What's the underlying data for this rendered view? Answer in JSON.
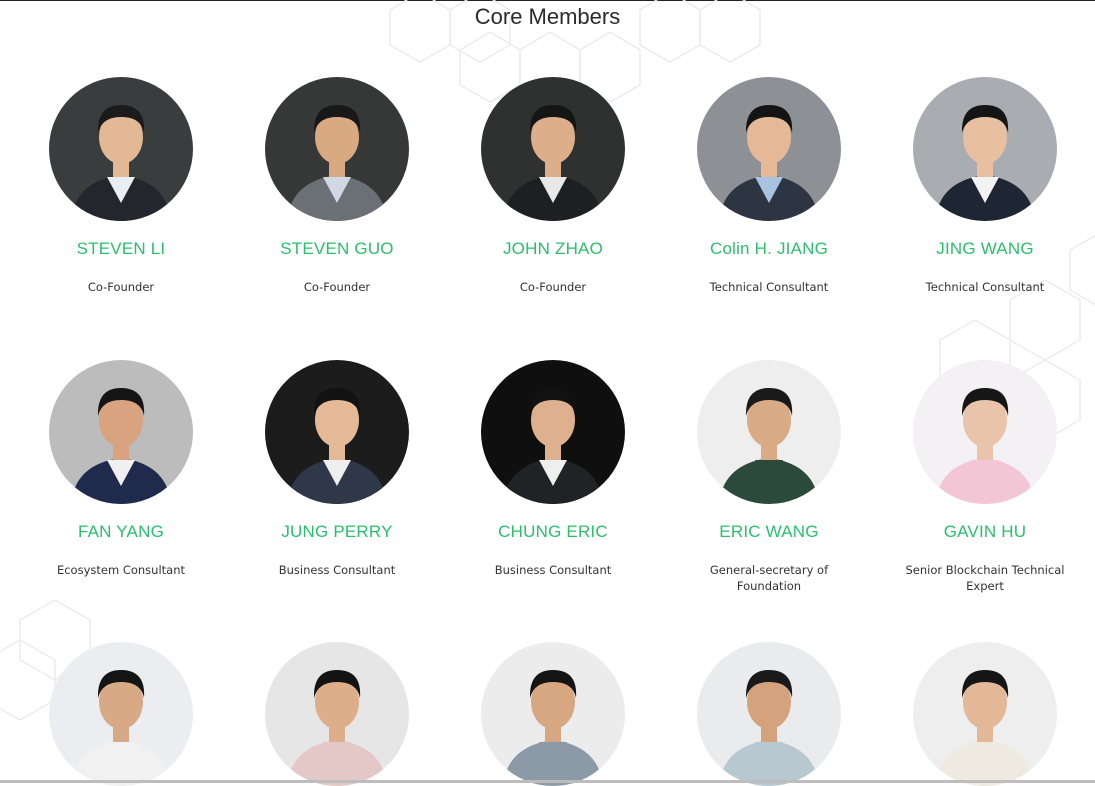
{
  "section": {
    "title": "Core Members"
  },
  "colors": {
    "name": "#29c06b",
    "text": "#333333"
  },
  "members": [
    {
      "name": "STEVEN LI",
      "role": "Co-Founder",
      "photo_bg": "#3a3d3e",
      "skin": "#e2b895",
      "hair": "#1b1b1b",
      "suit": "#23262c",
      "shirt": "#e9eef3"
    },
    {
      "name": "STEVEN GUO",
      "role": "Co-Founder",
      "photo_bg": "#353836",
      "skin": "#d9a982",
      "hair": "#181818",
      "suit": "#6b6f76",
      "shirt": "#cfd8e3"
    },
    {
      "name": "JOHN ZHAO",
      "role": "Co-Founder",
      "photo_bg": "#2f3130",
      "skin": "#dcae8a",
      "hair": "#151515",
      "suit": "#1d1f22",
      "shirt": "#e8e8e8"
    },
    {
      "name": "Colin H. JIANG",
      "role": "Technical Consultant",
      "photo_bg": "#8d9196",
      "skin": "#e6b996",
      "hair": "#141414",
      "suit": "#2e3542",
      "shirt": "#a8c2e0"
    },
    {
      "name": "JING WANG",
      "role": "Technical Consultant",
      "photo_bg": "#a9acb0",
      "skin": "#e8c0a1",
      "hair": "#151515",
      "suit": "#1f2633",
      "shirt": "#f2f2f2"
    },
    {
      "name": "FAN YANG",
      "role": "Ecosystem Consultant",
      "photo_bg": "#bcbcbc",
      "skin": "#d9a37f",
      "hair": "#151515",
      "suit": "#1f2a4d",
      "shirt": "#f0f0f0"
    },
    {
      "name": "JUNG PERRY",
      "role": "Business Consultant",
      "photo_bg": "#1c1c1c",
      "skin": "#e4b995",
      "hair": "#121212",
      "suit": "#2f3848",
      "shirt": "#eeeeee"
    },
    {
      "name": "CHUNG ERIC",
      "role": "Business Consultant",
      "photo_bg": "#0f0f0f",
      "skin": "#dfb08d",
      "hair": "#111111",
      "suit": "#202225",
      "shirt": "#efefef"
    },
    {
      "name": "ERIC WANG",
      "role": "General-secretary of Foundation",
      "photo_bg": "#eeeeee",
      "skin": "#d8aa86",
      "hair": "#1a1a1a",
      "suit": "#2c4a3c",
      "shirt": "#2c4a3c"
    },
    {
      "name": "GAVIN HU",
      "role": "Senior Blockchain Technical Expert",
      "photo_bg": "#f3f1f4",
      "skin": "#eac4aa",
      "hair": "#161616",
      "suit": "#f3c6d6",
      "shirt": "#f3c6d6"
    },
    {
      "name": "",
      "role": "",
      "photo_bg": "#ecedf0",
      "skin": "#d7a985",
      "hair": "#141414",
      "suit": "#f1f1f1",
      "shirt": "#f1f1f1"
    },
    {
      "name": "",
      "role": "",
      "photo_bg": "#e6e6e6",
      "skin": "#dcae8a",
      "hair": "#131313",
      "suit": "#e4c8c8",
      "shirt": "#e4c8c8"
    },
    {
      "name": "",
      "role": "",
      "photo_bg": "#ececec",
      "skin": "#d7a781",
      "hair": "#141414",
      "suit": "#8c9aa8",
      "shirt": "#8c9aa8"
    },
    {
      "name": "",
      "role": "",
      "photo_bg": "#e9ebec",
      "skin": "#d4a37e",
      "hair": "#1a1a1a",
      "suit": "#b8c8d0",
      "shirt": "#b8c8d0"
    },
    {
      "name": "",
      "role": "",
      "photo_bg": "#eeeeee",
      "skin": "#e2b896",
      "hair": "#151515",
      "suit": "#eeeae0",
      "shirt": "#eeeae0"
    }
  ]
}
